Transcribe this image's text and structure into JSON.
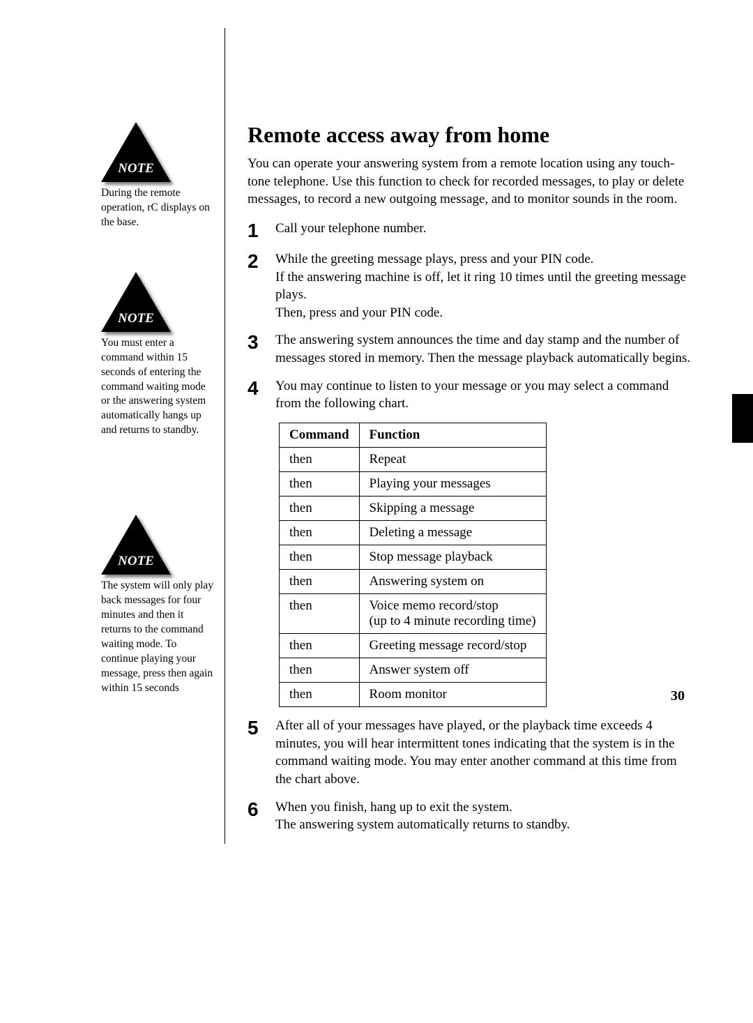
{
  "page_number": "30",
  "note_label": "NOTE",
  "sidebar": {
    "notes": [
      {
        "text": "During the remote operation, rC displays on the base."
      },
      {
        "text": "You must enter a command within 15 seconds of entering the command waiting mode or the answering system automatically hangs up and returns to standby."
      },
      {
        "text": "The system will only play back messages for four minutes and then it returns to the command waiting mode. To continue playing your message, press  then  again within 15 seconds"
      }
    ]
  },
  "main": {
    "title": "Remote access away from home",
    "intro": "You can operate your answering system from a remote location using any touch-tone telephone. Use this function to check for recorded messages, to play or delete messages, to record a new outgoing message, and to monitor sounds in the room.",
    "steps": [
      {
        "num": "1",
        "text": "Call your telephone number."
      },
      {
        "num": "2",
        "text": "While the greeting message plays, press  and your PIN code.\nIf the answering machine is off, let it ring 10 times until the greeting message plays.\nThen, press  and your PIN code."
      },
      {
        "num": "3",
        "text": "The answering system announces the time and day stamp and the number of messages stored in memory. Then the message playback automatically begins."
      },
      {
        "num": "4",
        "text": "You may continue to listen to your message or you may select a command from the following chart."
      },
      {
        "num": "5",
        "text": "After all of your messages have played, or the playback time exceeds 4 minutes, you will hear intermittent tones indicating that the system is in the command waiting mode. You may enter another command at this time from the chart above."
      },
      {
        "num": "6",
        "text": "When you finish, hang up to exit the system.\nThe answering system automatically returns to standby."
      }
    ],
    "table": {
      "headers": {
        "command": "Command",
        "function": "Function"
      },
      "rows": [
        {
          "command": " then ",
          "function": "Repeat"
        },
        {
          "command": " then ",
          "function": "Playing your messages"
        },
        {
          "command": " then ",
          "function": "Skipping a message"
        },
        {
          "command": " then ",
          "function": "Deleting a message"
        },
        {
          "command": " then ",
          "function": "Stop message playback"
        },
        {
          "command": " then ",
          "function": "Answering system on"
        },
        {
          "command": " then ",
          "function": "Voice memo record/stop\n(up to 4 minute recording time)"
        },
        {
          "command": " then ",
          "function": "Greeting message record/stop"
        },
        {
          "command": " then ",
          "function": "Answer system off"
        },
        {
          "command": " then ",
          "function": "Room monitor"
        }
      ]
    }
  }
}
